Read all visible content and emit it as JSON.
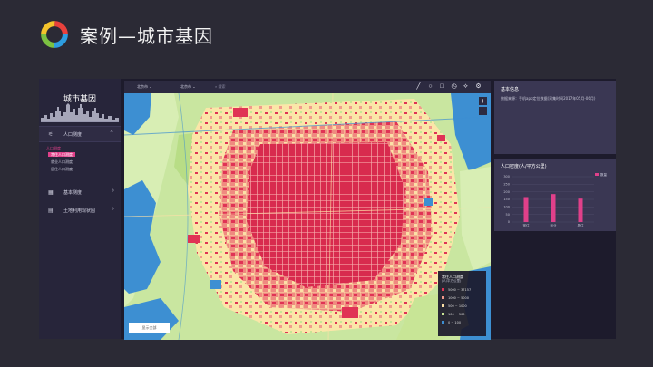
{
  "slide": {
    "title": "案例—城市基因"
  },
  "sidebar": {
    "brand_title": "城市基因",
    "groups": [
      {
        "label": "人口测度",
        "icon": "ruler-icon"
      },
      {
        "label": "基本测度",
        "icon": "building-icon"
      },
      {
        "label": "土地利用现状图",
        "icon": "document-icon"
      }
    ],
    "subsection_label": "人口测度",
    "subitems": [
      "常住人口测度",
      "就业人口测度",
      "居住人口测度"
    ]
  },
  "map": {
    "toolbar": {
      "dropdown1": "北京市",
      "dropdown2": "北京市",
      "search_placeholder": "搜索"
    },
    "zoom_in": "+",
    "zoom_out": "−",
    "legend": {
      "title": "常住人口测度",
      "unit": "(人/平方公里)",
      "entries": [
        {
          "label": "5000 ~ 37157",
          "color": "#e03355"
        },
        {
          "label": "1000 ~ 5000",
          "color": "#f29a8c"
        },
        {
          "label": "500 ~ 1000",
          "color": "#fbe0a6"
        },
        {
          "label": "100 ~ 500",
          "color": "#c8e596"
        },
        {
          "label": "0 ~ 100",
          "color": "#3d8fd2"
        }
      ]
    },
    "bottom_button": "显示全部"
  },
  "panels": {
    "info_title": "基本信息",
    "info_text": "数据来源：手机app定位数据(采集时间2017年05月-06月)",
    "chart_title": "人口密度(人/平方公里)"
  },
  "chart_data": {
    "type": "bar",
    "title": "人口密度(人/平方公里)",
    "categories": [
      "常住",
      "就业",
      "居住"
    ],
    "values": [
      165,
      185,
      155
    ],
    "ylim": [
      0,
      300
    ],
    "yticks": [
      0,
      50,
      100,
      150,
      200,
      250,
      300
    ],
    "legend": "top-right",
    "legend_label": "数量",
    "color": "#e0408a",
    "grid": true
  }
}
